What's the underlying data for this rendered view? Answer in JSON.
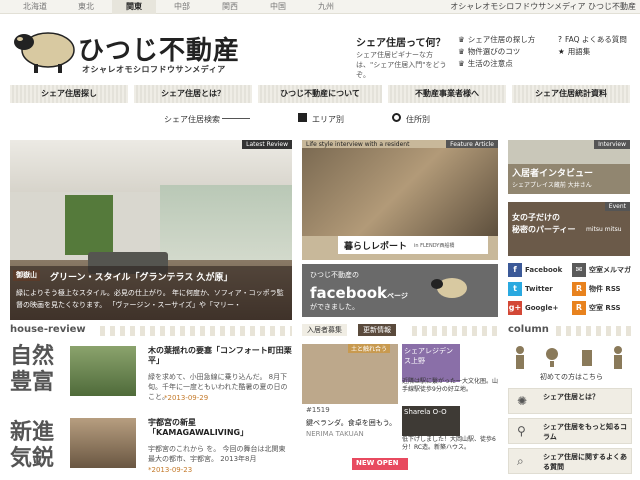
{
  "regions": [
    "北海道",
    "東北",
    "関東",
    "中部",
    "関西",
    "中国",
    "九州"
  ],
  "top_tagline": "オシャレオモシロフドウサンメディア ひつじ不動産",
  "brand": {
    "name": "ひつじ不動産",
    "sub": "オシャレオモシロフドウサンメディア"
  },
  "intro": {
    "title": "シェア住居って何？",
    "text": "シェア住居ビギナーな方は、\"シェア住居入門\"をどうぞ。"
  },
  "links": [
    {
      "icon": "♛",
      "label": "シェア住居の探し方"
    },
    {
      "icon": "♛",
      "label": "物件選びのコツ"
    },
    {
      "icon": "♛",
      "label": "生活の注意点"
    },
    {
      "icon": "?",
      "label": "FAQ よくある質問"
    },
    {
      "icon": "★",
      "label": "用語集"
    }
  ],
  "nav": [
    "シェア住居探し",
    "シェア住居とは？",
    "ひつじ不動産について",
    "不動産事業者様へ",
    "シェア住居統計資料"
  ],
  "search": {
    "label": "シェア住居検索",
    "area": "エリア別",
    "address": "住所別"
  },
  "hero": {
    "badge": "Latest Review",
    "location": "御嶽山",
    "title": "グリーン・スタイル「グランテラス 久が原」",
    "desc": "緑によりそう極上なスタイル。必見の仕上がり。 年に何度か、ソフィア・コッポラ監督の映画を見たくなります。 「ヴァージン・スーサイズ」や「マリー・"
  },
  "feature": {
    "badge": "Feature Article",
    "header": "Life style interview with a resident",
    "label": "暮らしレポート",
    "label_sub": "in FLENDY西船橋"
  },
  "facebook": {
    "top": "ひつじ不動産の",
    "brand": "facebook",
    "bottom": "ができました。",
    "suffix": "ページ"
  },
  "interview": {
    "badge": "Interview",
    "title": "入居者インタビュー",
    "sub": "シェアプレイス蔵前 大井さん"
  },
  "event": {
    "badge": "Event",
    "title": "女の子だけの",
    "title2": "秘密のパーティー",
    "sub": "mitsu mitsu"
  },
  "social": [
    {
      "icon": "f",
      "label": "Facebook",
      "color": "#3b5998"
    },
    {
      "icon": "✉",
      "label": "空室メルマガ",
      "color": "#5a5a5a"
    },
    {
      "icon": "t",
      "label": "Twitter",
      "color": "#2aa9e0"
    },
    {
      "icon": "R",
      "label": "物件 RSS",
      "color": "#e8821e"
    },
    {
      "icon": "g+",
      "label": "Google+",
      "color": "#d34836"
    },
    {
      "icon": "R",
      "label": "空室 RSS",
      "color": "#e8821e"
    }
  ],
  "review_section": {
    "heading": "house-review"
  },
  "reviews": [
    {
      "kanji": "自然豊富",
      "title": "木の葉揺れの要塞「コンフォート町田栗平」",
      "desc": "緑を求めて、小田急線に乗り込んだ。 8月下旬。千年に一度ともいわれた酷暑の夏の日のこと。",
      "date": "*2013-09-29"
    },
    {
      "kanji": "新進気鋭",
      "title": "宇都宮の新星「KAMAGAWALIVING」",
      "desc": "宇都宮のこれから を。 今回の舞台は北関東最大の都市、宇都宮。 2013年8月",
      "date": "*2013-09-23"
    }
  ],
  "tabs": {
    "recruit": "入居者募集",
    "update": "更新情報"
  },
  "cards": [
    {
      "tag": "土と触れ合う",
      "code": "#1519",
      "text": "鍵ベランダ。食卓を囲もう。",
      "name": "NERIMA TAKUAN"
    },
    {
      "tag": "シェアレジデンス上野",
      "text": "近隣は駅に繋がった一大文化圏。山手線駅徒歩9分の好立地。"
    },
    {
      "tag": "Sharela O-O",
      "text": "低下げしました！大岡山駅、徒歩6分！RC造。新築ハウス。"
    },
    {
      "tag": "NEW OPEN"
    }
  ],
  "column": {
    "heading": "column",
    "beginner": "初めての方はこちら",
    "items": [
      "シェア住居とは？",
      "シェア住居をもっと知るコラム",
      "シェア住居に関するよくある質問"
    ]
  }
}
